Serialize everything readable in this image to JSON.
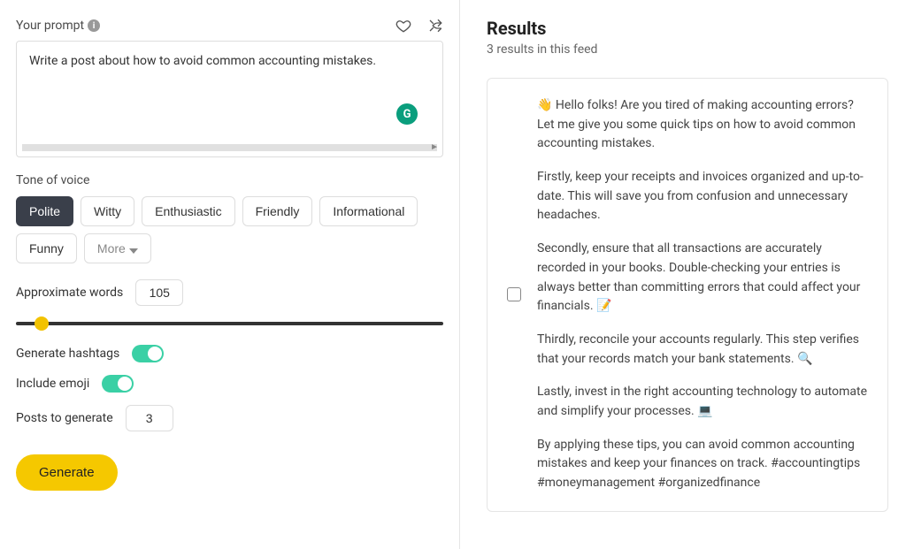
{
  "prompt": {
    "label": "Your prompt",
    "value": "Write a post about how to avoid common accounting mistakes."
  },
  "tone": {
    "label": "Tone of voice",
    "options": [
      "Polite",
      "Witty",
      "Enthusiastic",
      "Friendly",
      "Informational",
      "Funny"
    ],
    "more_label": "More",
    "selected": "Polite"
  },
  "words": {
    "label": "Approximate words",
    "value": "105"
  },
  "hashtags": {
    "label": "Generate hashtags",
    "on": true
  },
  "emoji": {
    "label": "Include emoji",
    "on": true
  },
  "posts": {
    "label": "Posts to generate",
    "value": "3"
  },
  "generate_label": "Generate",
  "results": {
    "title": "Results",
    "subtitle": "3 results in this feed",
    "items": [
      {
        "paragraphs": [
          "👋 Hello folks! Are you tired of making accounting errors? Let me give you some quick tips on how to avoid common accounting mistakes.",
          "Firstly, keep your receipts and invoices organized and up-to-date. This will save you from confusion and unnecessary headaches.",
          "Secondly, ensure that all transactions are accurately recorded in your books. Double-checking your entries is always better than committing errors that could affect your financials. 📝",
          "Thirdly, reconcile your accounts regularly. This step verifies that your records match your bank statements. 🔍",
          "Lastly, invest in the right accounting technology to automate and simplify your processes. 💻",
          "By applying these tips, you can avoid common accounting mistakes and keep your finances on track. #accountingtips #moneymanagement #organizedfinance"
        ]
      }
    ]
  }
}
